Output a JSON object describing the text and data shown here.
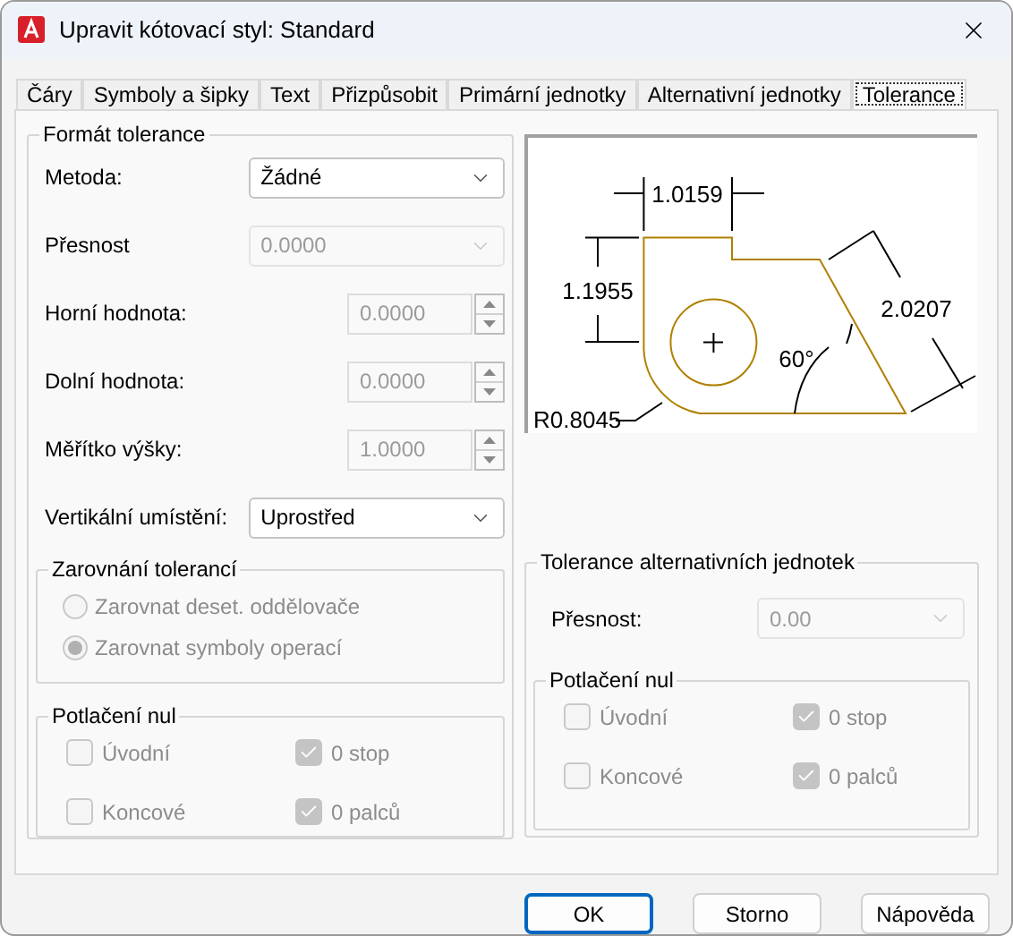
{
  "window": {
    "title": "Upravit kótovací styl: Standard"
  },
  "tabs": [
    {
      "label": "Čáry",
      "selected": false
    },
    {
      "label": "Symboly a šipky",
      "selected": false
    },
    {
      "label": "Text",
      "selected": false
    },
    {
      "label": "Přizpůsobit",
      "selected": false
    },
    {
      "label": "Primární jednotky",
      "selected": false
    },
    {
      "label": "Alternativní jednotky",
      "selected": false
    },
    {
      "label": "Tolerance",
      "selected": true
    }
  ],
  "tolerance_format": {
    "title": "Formát tolerance",
    "fields": [
      {
        "kind": "combo",
        "label": "Metoda:",
        "value": "Žádné",
        "disabled": false
      },
      {
        "kind": "combo",
        "label": "Přesnost",
        "value": "0.0000",
        "disabled": true
      },
      {
        "kind": "spinner",
        "label": "Horní hodnota:",
        "value": "0.0000",
        "disabled": true
      },
      {
        "kind": "spinner",
        "label": "Dolní hodnota:",
        "value": "0.0000",
        "disabled": true
      },
      {
        "kind": "spinner",
        "label": "Měřítko výšky:",
        "value": "1.0000",
        "disabled": true
      },
      {
        "kind": "combo",
        "label": "Vertikální umístění:",
        "value": "Uprostřed",
        "disabled": false
      }
    ]
  },
  "alignment": {
    "title": "Zarovnání tolerancí",
    "options": [
      {
        "label": "Zarovnat deset. oddělovače",
        "selected": false,
        "disabled": true
      },
      {
        "label": "Zarovnat symboly operací",
        "selected": true,
        "disabled": true
      }
    ]
  },
  "zero_suppression": {
    "title": "Potlačení nul",
    "options": [
      {
        "label": "Úvodní",
        "checked": false,
        "disabled": true
      },
      {
        "label": "0 stop",
        "checked": true,
        "disabled": true
      },
      {
        "label": "Koncové",
        "checked": false,
        "disabled": true
      },
      {
        "label": "0 palců",
        "checked": true,
        "disabled": true
      }
    ]
  },
  "preview": {
    "labels": [
      "1.0159",
      "1.1955",
      "2.0207",
      "60°",
      "R0.8045"
    ]
  },
  "alt_units": {
    "title": "Tolerance alternativních jednotek",
    "precision": {
      "label": "Přesnost:",
      "value": "0.00",
      "disabled": true
    },
    "zero_suppression": {
      "title": "Potlačení nul",
      "options": [
        {
          "label": "Úvodní",
          "checked": false,
          "disabled": true
        },
        {
          "label": "0 stop",
          "checked": true,
          "disabled": true
        },
        {
          "label": "Koncové",
          "checked": false,
          "disabled": true
        },
        {
          "label": "0 palců",
          "checked": true,
          "disabled": true
        }
      ]
    }
  },
  "buttons": [
    {
      "label": "OK",
      "default": true
    },
    {
      "label": "Storno",
      "default": false
    },
    {
      "label": "Nápověda",
      "default": false
    }
  ]
}
